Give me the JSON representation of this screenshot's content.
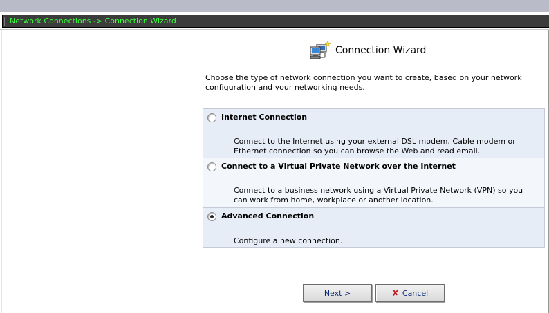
{
  "breadcrumb": "Network Connections -> Connection Wizard",
  "page_title": "Connection Wizard",
  "intro": "Choose the type of network connection you want to create, based on your network configuration and your networking needs.",
  "options": [
    {
      "label": "Internet Connection",
      "description": "Connect to the Internet using your external DSL modem, Cable modem or Ethernet connection so you can browse the Web and read email.",
      "selected": false
    },
    {
      "label": "Connect to a Virtual Private Network over the Internet",
      "description": "Connect to a business network using a Virtual Private Network (VPN) so you can work from home, workplace or another location.",
      "selected": false
    },
    {
      "label": "Advanced Connection",
      "description": "Configure a new connection.",
      "selected": true
    }
  ],
  "buttons": {
    "next": "Next >",
    "cancel": "Cancel"
  },
  "colors": {
    "breadcrumb_text": "#3cff3c",
    "breadcrumb_bg": "#3c3c3c",
    "option_bg_odd": "#e7edf7",
    "option_bg_even": "#f3f7fc",
    "button_text": "#0b2a78",
    "cancel_icon": "#c41010"
  },
  "icons": {
    "title": "network-wizard-icon",
    "cancel": "red-x-icon"
  }
}
